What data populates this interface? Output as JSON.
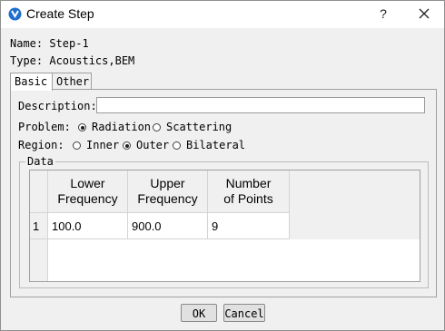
{
  "window": {
    "title": "Create Step",
    "help_label": "?",
    "accent_color": "#1f6fce"
  },
  "info": {
    "name": "Name: Step-1",
    "type": "Type: Acoustics,BEM"
  },
  "tabs": [
    {
      "label": "Basic",
      "active": true
    },
    {
      "label": "Other",
      "active": false
    }
  ],
  "basic": {
    "description_label": "Description:",
    "description_value": "",
    "problem_label": "Problem:",
    "problem_options": [
      {
        "label": "Radiation",
        "selected": true
      },
      {
        "label": "Scattering",
        "selected": false
      }
    ],
    "region_label": "Region:",
    "region_options": [
      {
        "label": "Inner",
        "selected": false
      },
      {
        "label": "Outer",
        "selected": true
      },
      {
        "label": "Bilateral",
        "selected": false
      }
    ]
  },
  "data_group": {
    "title": "Data",
    "columns": [
      "Lower\nFrequency",
      "Upper\nFrequency",
      "Number\nof Points"
    ],
    "rows": [
      {
        "index": "1",
        "cells": [
          "100.0",
          "900.0",
          "9"
        ]
      }
    ]
  },
  "buttons": {
    "ok_label": "OK",
    "cancel_label": "Cancel"
  }
}
